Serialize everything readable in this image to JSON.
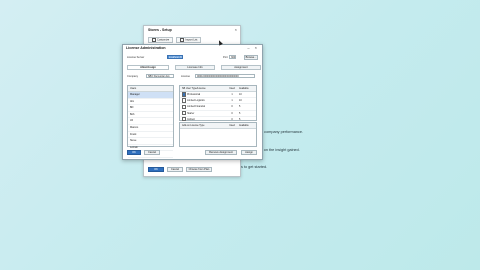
{
  "background_colors": {
    "start": "#d4eef3",
    "end": "#bde9ea"
  },
  "back_window": {
    "title": "Stores - Setup",
    "close_icon": "close-icon",
    "tabs": [
      "Customize",
      "Import List"
    ],
    "buttons": [
      "OK",
      "Cancel",
      "Choose from Plan"
    ]
  },
  "instructions": [
    "o company performance.",
    "il on the insight gained.",
    "s to get started."
  ],
  "dialog": {
    "title": "License Administration",
    "window_controls": "– ×",
    "license_server_label": "License Server",
    "license_server_value": "localhost:30000",
    "port_label": "Port",
    "port_value": "30000",
    "browse_button": "Browse...",
    "tabs": [
      "Alloc/Assign",
      "Licensee Info",
      "Assignment"
    ],
    "company_label": "Company",
    "company_value": "SBO Demoplan AG",
    "license_label": "License",
    "license_value": "000100000000000000000000000000",
    "users_header": "Users",
    "users": [
      "Manager",
      "Alix",
      "Bill",
      "Bob",
      "Jill",
      "Marcos",
      "Frank",
      "Steve",
      "Lorrain",
      "Laura",
      "Ethan"
    ],
    "grid1_headers": [
      "SB User Type/License",
      "Used",
      "Available"
    ],
    "grid1_rows": [
      {
        "name": "Professional",
        "used": "1",
        "avail": "10",
        "checked": true
      },
      {
        "name": "Limited Logistics",
        "used": "1",
        "avail": "10",
        "checked": false
      },
      {
        "name": "Limited Financial",
        "used": "0",
        "avail": "5",
        "checked": false
      },
      {
        "name": "Starter",
        "used": "0",
        "avail": "5",
        "checked": false
      },
      {
        "name": "Indirect",
        "used": "0",
        "avail": "5",
        "checked": false
      }
    ],
    "grid2_headers": [
      "Add-on License Type",
      "Used",
      "Available"
    ],
    "buttons": {
      "ok": "OK",
      "cancel": "Cancel",
      "remove": "Remove Assignment",
      "assign": "Assign"
    }
  }
}
